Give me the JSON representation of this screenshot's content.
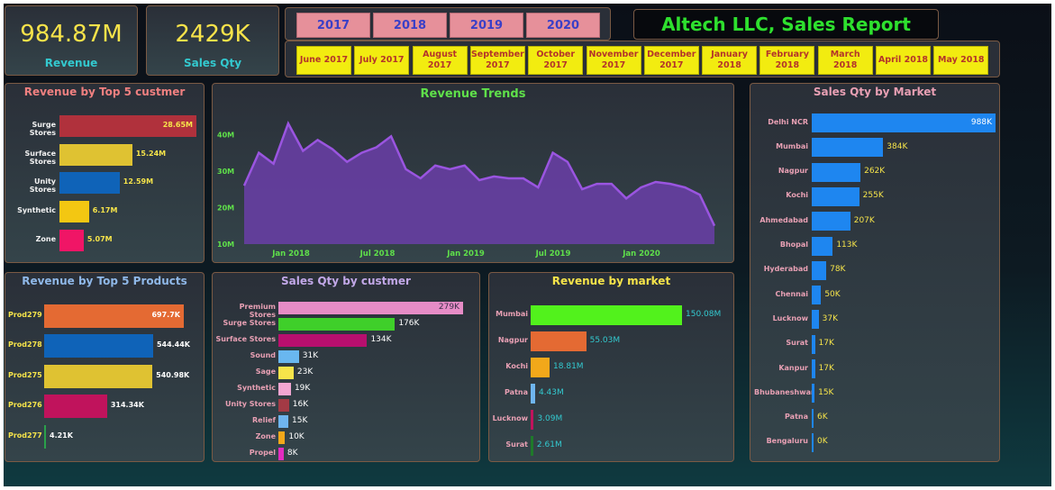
{
  "kpis": {
    "revenue": {
      "value": "984.87M",
      "label": "Revenue"
    },
    "sales_qty": {
      "value": "2429K",
      "label": "Sales Qty"
    }
  },
  "year_slicer": [
    "2017",
    "2018",
    "2019",
    "2020"
  ],
  "month_slicer": [
    {
      "line1": "June 2017",
      "line2": ""
    },
    {
      "line1": "July 2017",
      "line2": ""
    },
    {
      "line1": "August",
      "line2": "2017"
    },
    {
      "line1": "September",
      "line2": "2017"
    },
    {
      "line1": "October",
      "line2": "2017"
    },
    {
      "line1": "November",
      "line2": "2017"
    },
    {
      "line1": "December",
      "line2": "2017"
    },
    {
      "line1": "January",
      "line2": "2018"
    },
    {
      "line1": "February",
      "line2": "2018"
    },
    {
      "line1": "March 2018",
      "line2": ""
    },
    {
      "line1": "April 2018",
      "line2": ""
    },
    {
      "line1": "May 2018",
      "line2": ""
    }
  ],
  "report_title": "Altech LLC, Sales Report",
  "colors": {
    "kpi_value": "#f7e34a",
    "kpi_label": "#33c9cf",
    "title_green": "#2ee02e",
    "trend_fill": "#6a3ea8",
    "trend_line": "#9a55e0"
  },
  "chart_data": [
    {
      "id": "revenue_top5_customer",
      "type": "bar",
      "title": "Revenue by Top 5 custmer",
      "categories": [
        "Surge Stores",
        "Surface Stores",
        "Unity Stores",
        "Synthetic",
        "Zone"
      ],
      "values": [
        28.65,
        15.24,
        12.59,
        6.17,
        5.07
      ],
      "labels": [
        "28.65M",
        "15.24M",
        "12.59M",
        "6.17M",
        "5.07M"
      ],
      "colors": [
        "#b0313c",
        "#dfc232",
        "#0f63b8",
        "#f3c712",
        "#f01566"
      ]
    },
    {
      "id": "revenue_trends",
      "type": "area",
      "title": "Revenue Trends",
      "x_ticks": [
        "Jan 2018",
        "Jul 2018",
        "Jan 2019",
        "Jul 2019",
        "Jan 2020"
      ],
      "y_ticks": [
        "10M",
        "20M",
        "30M",
        "40M"
      ],
      "ylim": [
        10,
        45
      ],
      "values": [
        26,
        35,
        32,
        43,
        35.5,
        38.5,
        36,
        32.5,
        35,
        36.5,
        39.5,
        30.5,
        28,
        31.5,
        30.5,
        31.5,
        27.5,
        28.5,
        28,
        28,
        25.5,
        35,
        32.5,
        25,
        26.5,
        26.5,
        22.5,
        25.5,
        27,
        26.5,
        25.5,
        23.5,
        15
      ]
    },
    {
      "id": "sales_qty_market",
      "type": "bar",
      "title": "Sales Qty by Market",
      "categories": [
        "Delhi NCR",
        "Mumbai",
        "Nagpur",
        "Kochi",
        "Ahmedabad",
        "Bhopal",
        "Hyderabad",
        "Chennai",
        "Lucknow",
        "Surat",
        "Kanpur",
        "Bhubaneshwar",
        "Patna",
        "Bengaluru"
      ],
      "values": [
        988,
        384,
        262,
        255,
        207,
        113,
        78,
        50,
        37,
        17,
        17,
        15,
        6,
        0
      ],
      "labels": [
        "988K",
        "384K",
        "262K",
        "255K",
        "207K",
        "113K",
        "78K",
        "50K",
        "37K",
        "17K",
        "17K",
        "15K",
        "6K",
        "0K"
      ]
    },
    {
      "id": "revenue_top5_products",
      "type": "bar",
      "title": "Revenue by Top 5 Products",
      "categories": [
        "Prod279",
        "Prod278",
        "Prod275",
        "Prod276",
        "Prod277"
      ],
      "values": [
        697.7,
        544.44,
        540.98,
        314.34,
        4.21
      ],
      "labels": [
        "697.7K",
        "544.44K",
        "540.98K",
        "314.34K",
        "4.21K"
      ],
      "colors": [
        "#e46a33",
        "#0f63b8",
        "#dfc232",
        "#c0135c",
        "#2aa04a"
      ]
    },
    {
      "id": "sales_qty_customer",
      "type": "bar",
      "title": "Sales Qty by custmer",
      "categories": [
        "Premium Stores",
        "Surge Stores",
        "Surface Stores",
        "Sound",
        "Sage",
        "Synthetic",
        "Unity Stores",
        "Relief",
        "Zone",
        "Propel"
      ],
      "values": [
        279,
        176,
        134,
        31,
        23,
        19,
        16,
        15,
        10,
        8
      ],
      "labels": [
        "279K",
        "176K",
        "134K",
        "31K",
        "23K",
        "19K",
        "16K",
        "15K",
        "10K",
        "8K"
      ],
      "colors": [
        "#e68cc6",
        "#3fcf2a",
        "#b80f6e",
        "#69b7f0",
        "#f6e44a",
        "#f2a6d2",
        "#a33a45",
        "#6fb5ee",
        "#f2a81a",
        "#e22cc0"
      ]
    },
    {
      "id": "revenue_market",
      "type": "bar",
      "title": "Revenue by market",
      "categories": [
        "Mumbai",
        "Nagpur",
        "Kochi",
        "Patna",
        "Lucknow",
        "Surat"
      ],
      "values": [
        150.08,
        55.03,
        18.81,
        4.43,
        3.09,
        2.61
      ],
      "labels": [
        "150.08M",
        "55.03M",
        "18.81M",
        "4.43M",
        "3.09M",
        "2.61M"
      ],
      "colors": [
        "#52f21c",
        "#e46a33",
        "#f2a81a",
        "#6fb5ee",
        "#c0135c",
        "#1f7a2a"
      ]
    }
  ]
}
